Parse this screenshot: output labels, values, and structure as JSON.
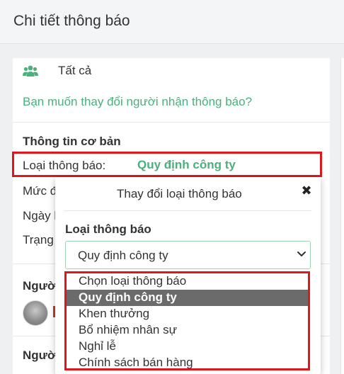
{
  "page": {
    "title": "Chi tiết thông báo"
  },
  "recipients": {
    "icon": "users-icon",
    "value": "Tất cả",
    "change_link": "Bạn muốn thay đổi người nhận thông báo?"
  },
  "basic_info": {
    "heading": "Thông tin cơ bản",
    "type_label": "Loại thông báo:",
    "type_value": "Quy định công ty",
    "level_label": "Mức đ",
    "date_label": "Ngày l",
    "status_label": "Trạng"
  },
  "people_section_1": "Người",
  "people_section_2": "Người",
  "modal": {
    "title": "Thay đổi loại thông báo",
    "close_icon": "close-icon",
    "field_label": "Loại thông báo",
    "selected_value": "Quy định công ty",
    "options": [
      {
        "label": "Chọn loại thông báo",
        "selected": false
      },
      {
        "label": "Quy định công ty",
        "selected": true
      },
      {
        "label": "Khen thưởng",
        "selected": false
      },
      {
        "label": "Bổ nhiệm nhân sự",
        "selected": false
      },
      {
        "label": "Nghỉ lễ",
        "selected": false
      },
      {
        "label": "Chính sách bán hàng",
        "selected": false
      }
    ]
  },
  "colors": {
    "accent_green": "#4caf7d",
    "highlight_red": "#e0161e",
    "selected_option_bg": "#6b6b6b"
  }
}
